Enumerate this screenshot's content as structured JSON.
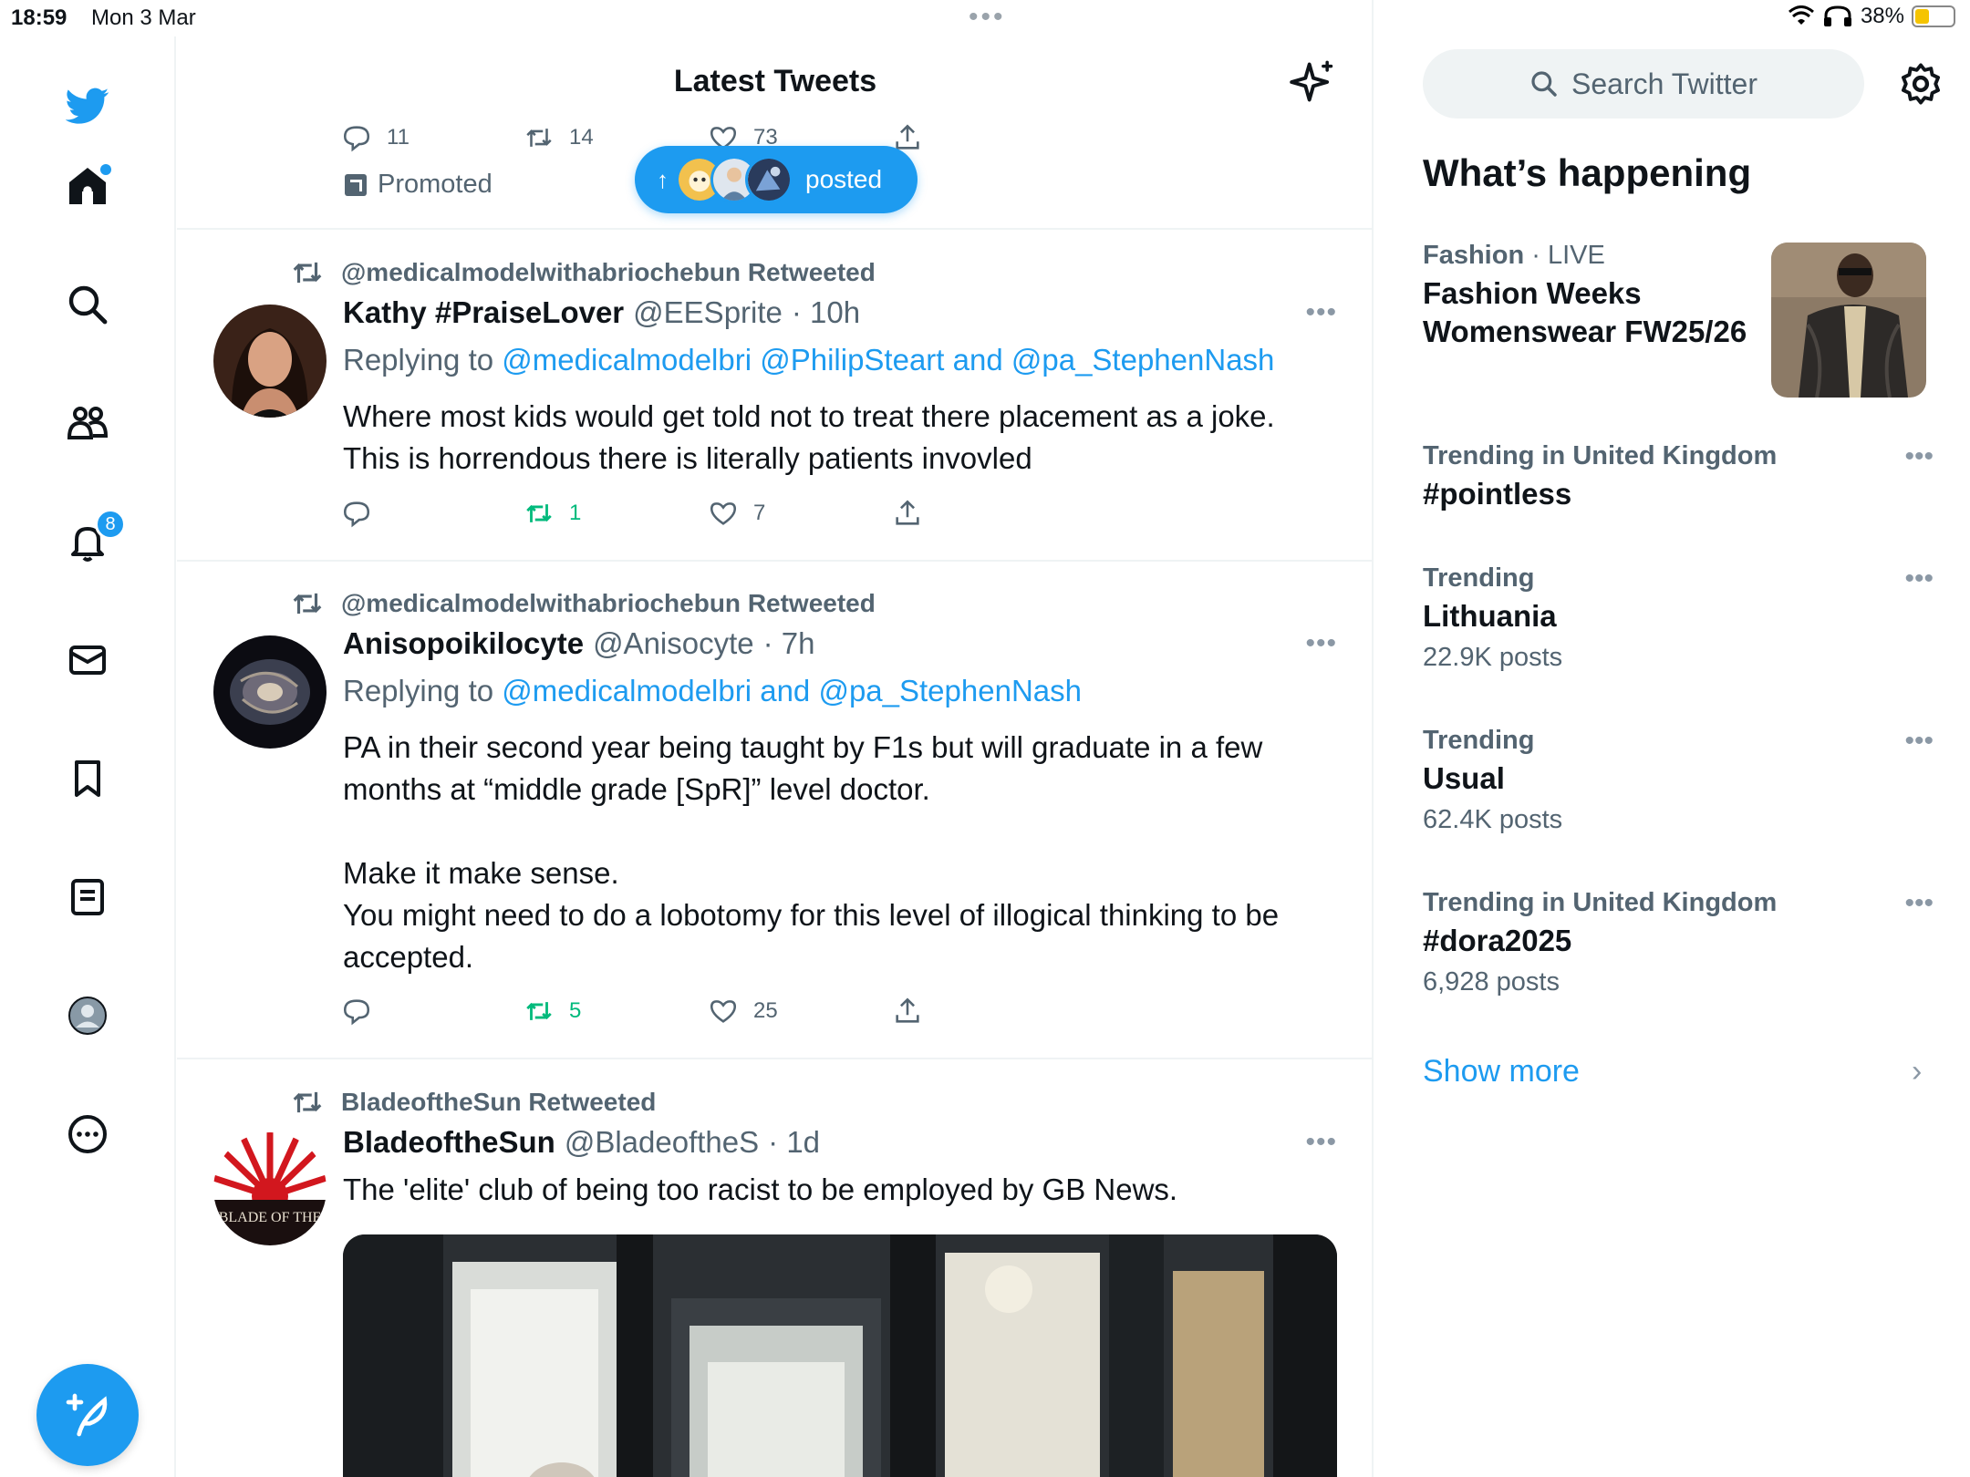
{
  "status_bar": {
    "time": "18:59",
    "date": "Mon 3 Mar",
    "battery": "38%",
    "battery_level": 0.38
  },
  "colors": {
    "accent": "#1d9bf0",
    "retweet_green": "#00ba7c",
    "secondary_text": "#536471"
  },
  "nav": {
    "notifications_badge": "8",
    "items": [
      "twitter-logo-icon",
      "home-icon",
      "search-icon",
      "communities-icon",
      "bell-icon",
      "mail-icon",
      "bookmark-icon",
      "lists-icon",
      "profile-avatar",
      "more-icon"
    ]
  },
  "main": {
    "title": "Latest Tweets",
    "promoted_tweet": {
      "replies": "11",
      "retweets": "14",
      "likes": "73",
      "promoted_label": "Promoted"
    },
    "new_posts_pill": {
      "label": "posted"
    },
    "tweets": [
      {
        "retweeted_by": "@medicalmodelwithabriochebun Retweeted",
        "name": "Kathy #PraiseLover",
        "handle": "@EESprite",
        "time": "· 10h",
        "reply_prefix": "Replying to",
        "reply_to": "@medicalmodelbri @PhilipSteart and @pa_StephenNash",
        "text": "Where most kids would get told not to treat there placement as a joke. This is horrendous there is literally patients invovled",
        "retweets": "1",
        "likes": "7"
      },
      {
        "retweeted_by": "@medicalmodelwithabriochebun Retweeted",
        "name": "Anisopoikilocyte",
        "handle": "@Anisocyte",
        "time": "· 7h",
        "reply_prefix": "Replying to",
        "reply_to": "@medicalmodelbri and @pa_StephenNash",
        "text": "PA in their second year being taught by F1s but will graduate in a few months at “middle grade [SpR]” level doctor.\n\nMake it make sense.\nYou might need to do a lobotomy for this level of illogical thinking to be accepted.",
        "retweets": "5",
        "likes": "25"
      },
      {
        "retweeted_by": "BladeoftheSun Retweeted",
        "name": "BladeoftheSun",
        "handle": "@BladeoftheS",
        "time": "· 1d",
        "text": "The 'elite' club of being too racist to be employed by GB News.",
        "avatar_text": "BLADE OF THE"
      }
    ]
  },
  "sidebar": {
    "search_placeholder": "Search Twitter",
    "heading": "What’s happening",
    "trends": [
      {
        "category": "Fashion",
        "meta_suffix": " · LIVE",
        "title": "Fashion Weeks Womenswear FW25/26"
      },
      {
        "category": "Trending in United Kingdom",
        "title": "#pointless"
      },
      {
        "category": "Trending",
        "title": "Lithuania",
        "count": "22.9K posts"
      },
      {
        "category": "Trending",
        "title": "Usual",
        "count": "62.4K posts"
      },
      {
        "category": "Trending in United Kingdom",
        "title": "#dora2025",
        "count": "6,928 posts"
      }
    ],
    "show_more": "Show more"
  }
}
